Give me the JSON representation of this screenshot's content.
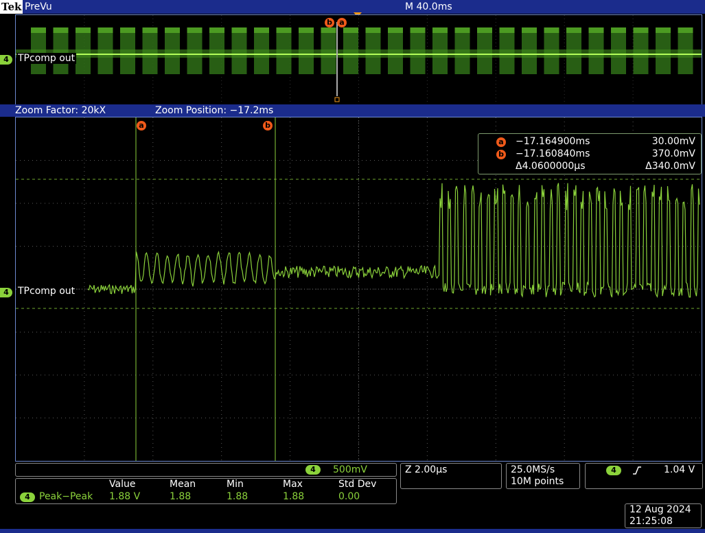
{
  "header": {
    "brand": "Tek",
    "mode": "PreVu",
    "timebase": "M 40.0ms"
  },
  "overview": {
    "channel_number": "4",
    "channel_label": "TPcomp out",
    "cursor_a": "a",
    "cursor_b": "b"
  },
  "zoom": {
    "factor": "Zoom Factor: 20kX",
    "position": "Zoom Position: −17.2ms"
  },
  "main": {
    "channel_number": "4",
    "channel_label": "TPcomp out",
    "cursor_a": "a",
    "cursor_b": "b"
  },
  "cursor_readout": {
    "a_symbol": "a",
    "a_time": "−17.164900ms",
    "a_value": "30.00mV",
    "b_symbol": "b",
    "b_time": "−17.160840ms",
    "b_value": "370.0mV",
    "delta_time": "Δ4.0600000µs",
    "delta_value": "Δ340.0mV"
  },
  "status": {
    "channel_number": "4",
    "volts_per_div": "500mV",
    "zoom_scale": "Z 2.00µs",
    "sample_rate": "25.0MS/s",
    "record_length": "10M points",
    "trigger_channel": "4",
    "trigger_slope_icon": "rising-edge-icon",
    "trigger_level": "1.04 V"
  },
  "measurements": {
    "headers": [
      "Value",
      "Mean",
      "Min",
      "Max",
      "Std Dev"
    ],
    "rows": [
      {
        "channel": "4",
        "name": "Peak−Peak",
        "value": "1.88 V",
        "mean": "1.88",
        "min": "1.88",
        "max": "1.88",
        "std_dev": "0.00"
      }
    ]
  },
  "datetime": {
    "date": "12 Aug 2024",
    "time": "21:25:08"
  },
  "colors": {
    "trace": "#8bd23b",
    "cursor_bubble": "#f05a1a",
    "frame": "#1b2c8c",
    "trigger_marker": "#f39a1a"
  }
}
